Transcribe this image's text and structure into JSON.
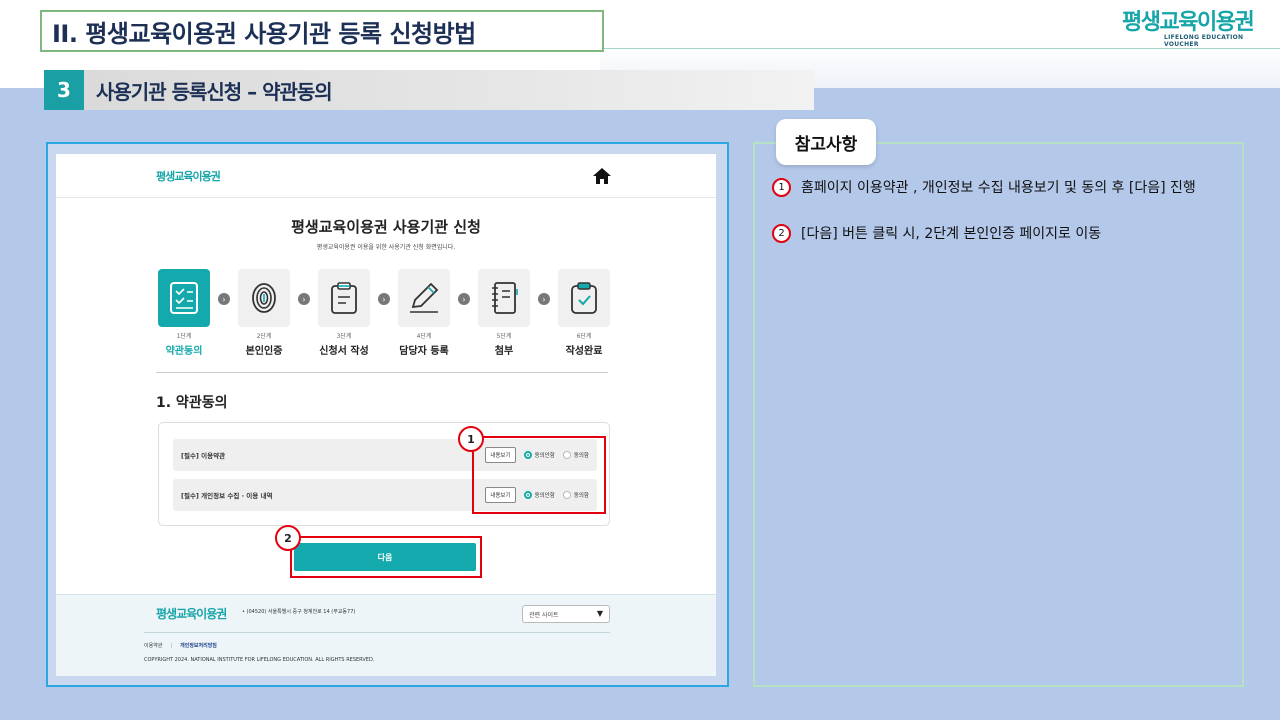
{
  "slide": {
    "title": "II. 평생교육이용권 사용기관 등록 신청방법",
    "brand_logo": "평생교육이용권",
    "brand_logo_en": "LIFELONG EDUCATION VOUCHER",
    "section_number": "3",
    "section_title": "사용기관 등록신청 – 약관동의"
  },
  "screenshot": {
    "header_logo": "평생교육이용권",
    "page_title": "평생교육이용권 사용기관 신청",
    "page_subtitle": "평생교육이용권 이용을 위한 사용기관 신청 화면입니다.",
    "steps": [
      {
        "step": "1단계",
        "label": "약관동의"
      },
      {
        "step": "2단계",
        "label": "본인인증"
      },
      {
        "step": "3단계",
        "label": "신청서 작성"
      },
      {
        "step": "4단계",
        "label": "담당자 등록"
      },
      {
        "step": "5단계",
        "label": "첨부"
      },
      {
        "step": "6단계",
        "label": "작성완료"
      }
    ],
    "section_heading": "1. 약관동의",
    "terms": [
      {
        "label": "[필수] 이용약관",
        "view": "내용보기",
        "agree": "동의안함",
        "disagree": "동의함"
      },
      {
        "label": "[필수] 개인정보 수집 · 이용 내역",
        "view": "내용보기",
        "agree": "동의안함",
        "disagree": "동의함"
      }
    ],
    "next_button": "다음",
    "callouts": [
      "1",
      "2"
    ],
    "footer": {
      "logo": "평생교육이용권",
      "address": "• (04520) 서울특별시 중구 청계천로 14 (무교동77)",
      "related_sites": "관련 사이트",
      "link_terms": "이용약관",
      "link_separator": "|",
      "link_privacy": "개인정보처리방침",
      "copyright": "COPYRIGHT 2024. NATIONAL INSTITUTE FOR LIFELONG EDUCATION. ALL RIGHTS RESERVED."
    }
  },
  "notes": {
    "tag": "참고사항",
    "items": [
      {
        "num": "1",
        "text": "홈페이지 이용약관 , 개인정보 수집 내용보기 및 동의 후 [다음] 진행"
      },
      {
        "num": "2",
        "text": "[다음] 버튼 클릭 시, 2단계 본인인증 페이지로 이동"
      }
    ]
  }
}
